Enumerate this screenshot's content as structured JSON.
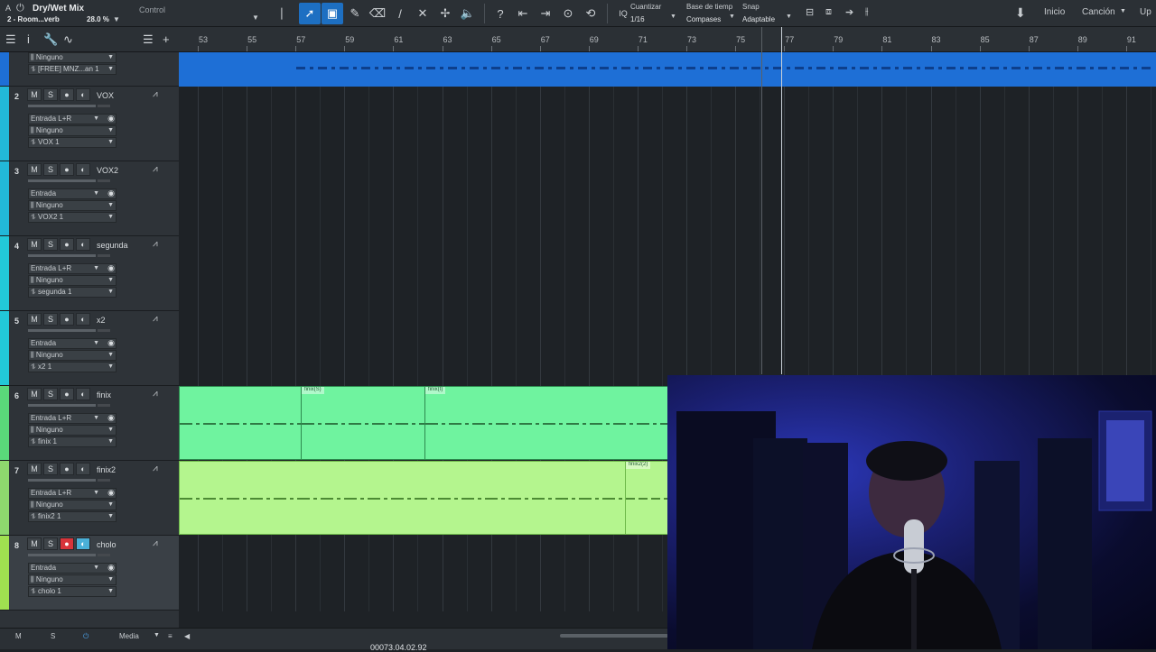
{
  "topbar": {
    "title": "Dry/Wet Mix",
    "subtitle": "2 - Room...verb",
    "zoom": "28.0 %",
    "control_label": "Control",
    "quantize_label": "Cuantizar",
    "quantize_value": "1/16",
    "timebase_label": "Base de tiemp",
    "timebase_value": "Compases",
    "snap_label": "Snap",
    "snap_value": "Adaptable",
    "nav_inicio": "Inicio",
    "nav_cancion": "Canción",
    "nav_more": "Up"
  },
  "ruler": {
    "labels": [
      "53",
      "55",
      "57",
      "59",
      "61",
      "63",
      "65",
      "67",
      "69",
      "71",
      "73",
      "75",
      "77",
      "79",
      "81",
      "83",
      "85",
      "87",
      "89",
      "91"
    ]
  },
  "tracks": [
    {
      "num": "",
      "name": "",
      "input": "",
      "bus": "Ninguno",
      "layer": "[FREE] MNZ...an 1",
      "color": "#1e6fd6"
    },
    {
      "num": "2",
      "name": "VOX",
      "input": "Entrada L+R",
      "bus": "Ninguno",
      "layer": "VOX 1",
      "color": "#22b8d8"
    },
    {
      "num": "3",
      "name": "VOX2",
      "input": "Entrada",
      "bus": "Ninguno",
      "layer": "VOX2 1",
      "color": "#22b8d8"
    },
    {
      "num": "4",
      "name": "segunda",
      "input": "Entrada L+R",
      "bus": "Ninguno",
      "layer": "segunda 1",
      "color": "#22c8d8"
    },
    {
      "num": "5",
      "name": "x2",
      "input": "Entrada",
      "bus": "Ninguno",
      "layer": "x2 1",
      "color": "#22c8d8"
    },
    {
      "num": "6",
      "name": "finix",
      "input": "Entrada L+R",
      "bus": "Ninguno",
      "layer": "finix 1",
      "color": "#5ad87a"
    },
    {
      "num": "7",
      "name": "finix2",
      "input": "Entrada L+R",
      "bus": "Ninguno",
      "layer": "finix2 1",
      "color": "#8ed86e"
    },
    {
      "num": "8",
      "name": "cholo",
      "input": "Entrada",
      "bus": "Ninguno",
      "layer": "cholo 1",
      "color": "#a0e050"
    }
  ],
  "buttons": {
    "mute": "M",
    "solo": "S"
  },
  "clips": {
    "finix_a": "finix(S)",
    "finix_b": "finix(t)",
    "finix2_a": "finix2(2)"
  },
  "bottombar": {
    "m": "M",
    "s": "S",
    "media": "Media",
    "time": "00073.04.02.92"
  },
  "colors": {
    "accent": "#1d6fc2",
    "clip_green": "#6ff39f",
    "clip_lime": "#b4f58e"
  }
}
